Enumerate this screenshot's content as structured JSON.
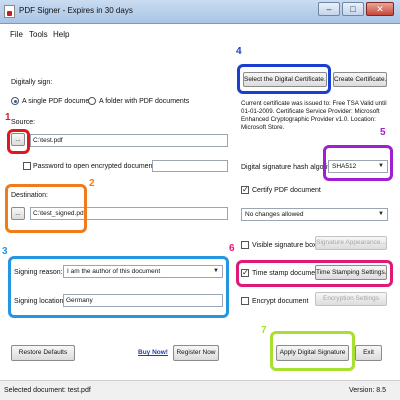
{
  "window": {
    "title": "PDF Signer - Expires in 30 days",
    "minimize_glyph": "–",
    "maximize_glyph": "□",
    "close_glyph": "✕"
  },
  "menu": [
    "File",
    "Tools",
    "Help"
  ],
  "digitally_sign": {
    "label": "Digitally sign:",
    "option_single": "A single PDF document",
    "option_folder": "A folder with PDF documents"
  },
  "source": {
    "label": "Source:",
    "browse": "...",
    "value": "C:\\test.pdf",
    "password_label": "Password to open encrypted documents:",
    "password_value": ""
  },
  "destination": {
    "label": "Destination:",
    "browse": "...",
    "value": "C:\\test_signed.pdf"
  },
  "signing": {
    "reason_label": "Signing reason:",
    "reason_value": "I am the author of this document",
    "location_label": "Signing location:",
    "location_value": "Germany"
  },
  "certificate": {
    "select_button": "Select the Digital Certificate...",
    "create_button": "Create Certificate...",
    "info": "Current certificate was issued to: Free TSA Valid until 01-01-2009. Certificate Service Provider: Microsoft Enhanced Cryptographic Provider v1.0. Location: Microsoft Store."
  },
  "digest": {
    "label": "Digital signature hash algorithm:",
    "value": "SHA512"
  },
  "certify": {
    "checked": true,
    "label": "Certify PDF document",
    "changes_value": "No changes allowed"
  },
  "visible_signature": {
    "checked": false,
    "label": "Visible signature box",
    "appearance_button": "Signature Appearance..."
  },
  "timestamp": {
    "checked": true,
    "label": "Time stamp document",
    "settings_button": "Time Stamping Settings..."
  },
  "encrypt": {
    "checked": false,
    "label": "Encrypt document",
    "settings_button": "Encryption Settings"
  },
  "bottom": {
    "restore_button": "Restore Defaults",
    "buy_link": "Buy Now!",
    "register_button": "Register Now",
    "apply_button": "Apply Digital Signature",
    "exit_button": "Exit"
  },
  "status": {
    "left": "Selected document: test.pdf",
    "right": "Version: 8.5"
  },
  "annotations": [
    {
      "num": "1",
      "color": "#e0181e"
    },
    {
      "num": "2",
      "color": "#f07b1a"
    },
    {
      "num": "3",
      "color": "#2596e0"
    },
    {
      "num": "4",
      "color": "#1a3fd0"
    },
    {
      "num": "5",
      "color": "#a020d0"
    },
    {
      "num": "6",
      "color": "#e0187a"
    },
    {
      "num": "7",
      "color": "#a8e030"
    }
  ],
  "check_glyph": "✓",
  "dropdown_glyph": "▼"
}
